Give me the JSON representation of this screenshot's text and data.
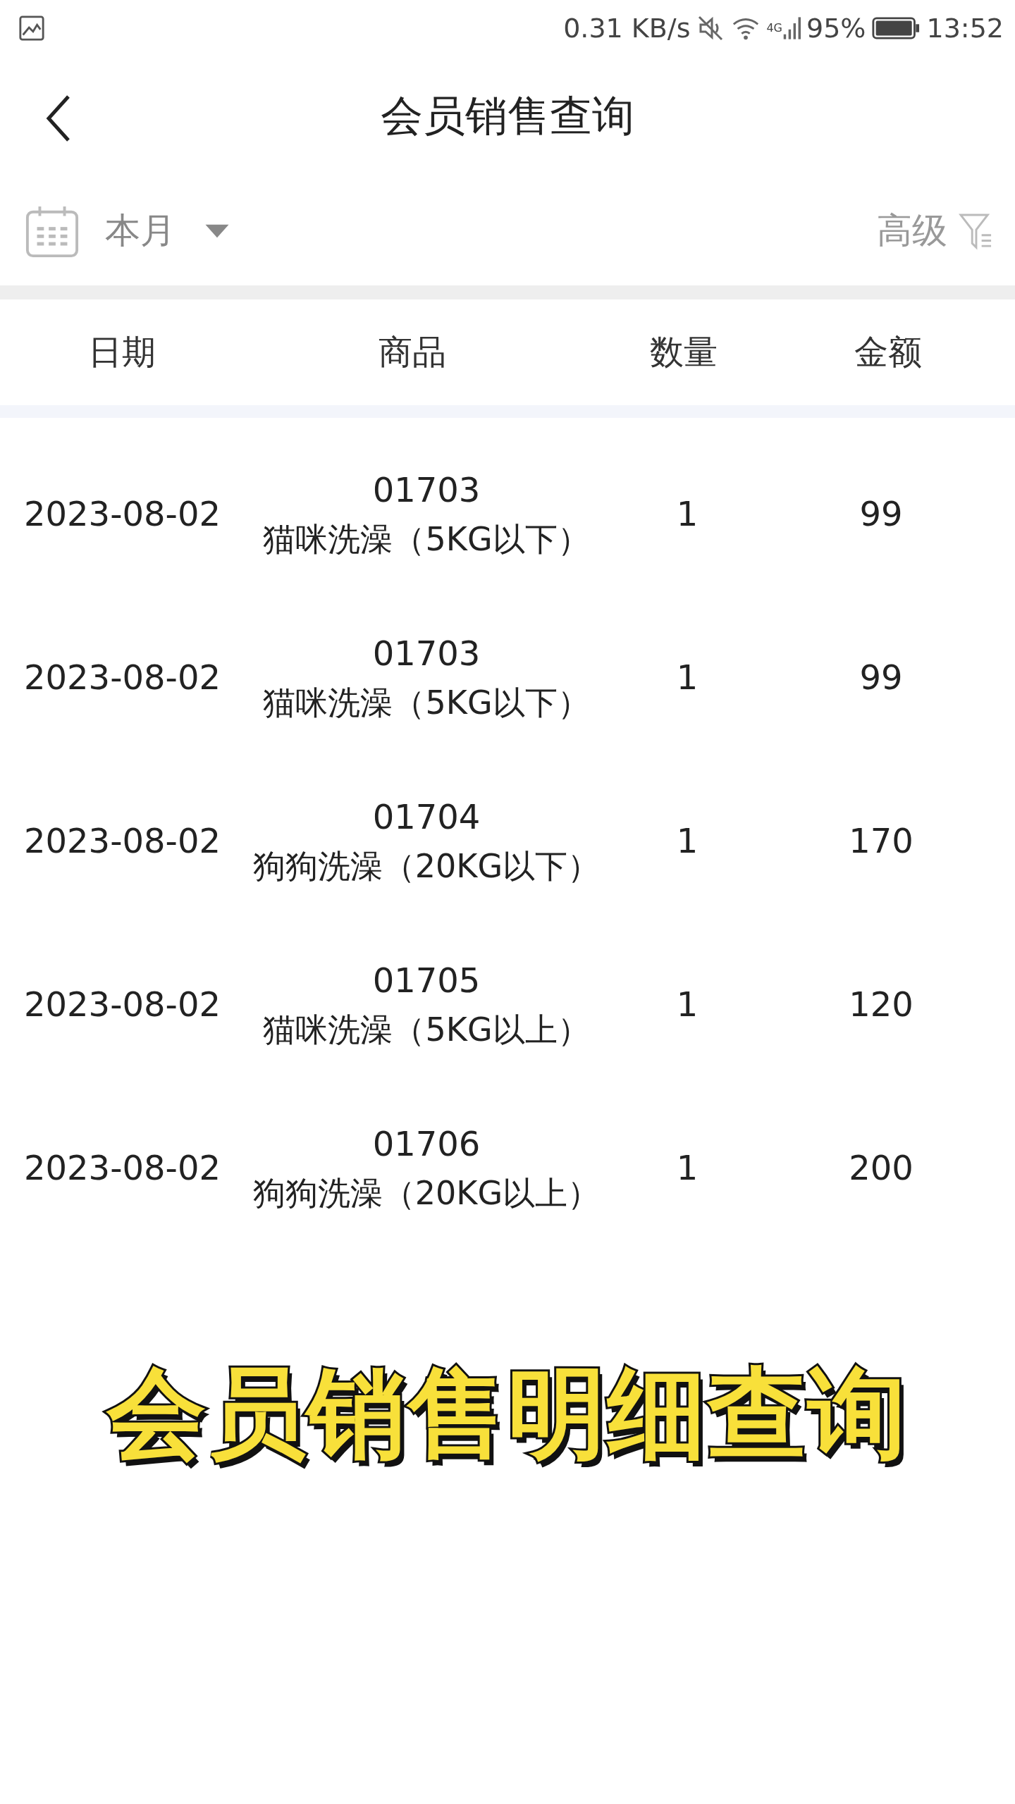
{
  "status_bar": {
    "speed": "0.31 KB/s",
    "network": "4G",
    "battery": "95%",
    "time": "13:52"
  },
  "header": {
    "title": "会员销售查询"
  },
  "filter_bar": {
    "period": "本月",
    "advanced": "高级"
  },
  "table": {
    "columns": [
      "日期",
      "商品",
      "数量",
      "金额"
    ],
    "rows": [
      {
        "date": "2023-08-02",
        "code": "01703",
        "product": "猫咪洗澡（5KG以下）",
        "quantity": "1",
        "amount": "99"
      },
      {
        "date": "2023-08-02",
        "code": "01703",
        "product": "猫咪洗澡（5KG以下）",
        "quantity": "1",
        "amount": "99"
      },
      {
        "date": "2023-08-02",
        "code": "01704",
        "product": "狗狗洗澡（20KG以下）",
        "quantity": "1",
        "amount": "170"
      },
      {
        "date": "2023-08-02",
        "code": "01705",
        "product": "猫咪洗澡（5KG以上）",
        "quantity": "1",
        "amount": "120"
      },
      {
        "date": "2023-08-02",
        "code": "01706",
        "product": "狗狗洗澡（20KG以上）",
        "quantity": "1",
        "amount": "200"
      }
    ]
  },
  "caption": "会员销售明细查询"
}
